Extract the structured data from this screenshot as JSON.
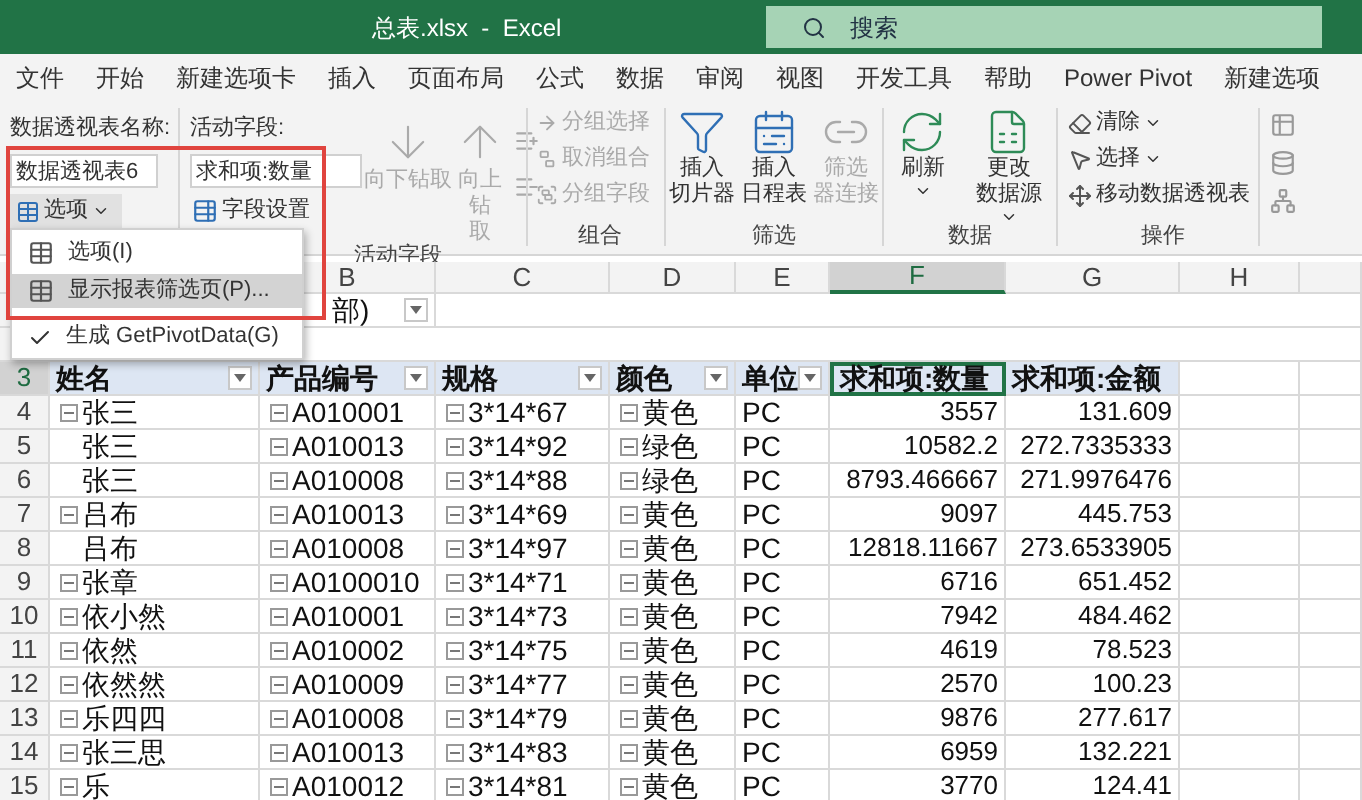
{
  "window": {
    "title": "总表.xlsx  -  Excel",
    "search": {
      "placeholder": "搜索"
    }
  },
  "tabs": [
    "文件",
    "开始",
    "新建选项卡",
    "插入",
    "页面布局",
    "公式",
    "数据",
    "审阅",
    "视图",
    "开发工具",
    "帮助",
    "Power Pivot",
    "新建选项"
  ],
  "ribbon": {
    "pivot": {
      "label": "数据透视表名称:",
      "value": "数据透视表6",
      "button": "选项"
    },
    "active_field": {
      "label": "活动字段:",
      "value": "求和项:数量",
      "button": "字段设置",
      "drill_down": {
        "label_lines": [
          "向下钻取"
        ],
        "disabled": true
      },
      "drill_up": {
        "label_lines": [
          "向上钻",
          "取"
        ],
        "disabled": true
      },
      "group_label": "活动字段"
    },
    "group": {
      "items": [
        {
          "label": "分组选择",
          "disabled": true
        },
        {
          "label": "取消组合",
          "disabled": true
        },
        {
          "label": "分组字段",
          "disabled": true
        }
      ],
      "group_label": "组合"
    },
    "filter": {
      "items": [
        {
          "kind": "slicer",
          "label_lines": [
            "插入",
            "切片器"
          ],
          "disabled": false
        },
        {
          "kind": "timeline",
          "label_lines": [
            "插入",
            "日程表"
          ],
          "disabled": false
        },
        {
          "kind": "connections",
          "label_lines": [
            "筛选",
            "器连接"
          ],
          "disabled": true
        }
      ],
      "group_label": "筛选"
    },
    "data": {
      "items": [
        {
          "kind": "refresh",
          "label_lines": [
            "刷新"
          ]
        },
        {
          "kind": "source",
          "label_lines": [
            "更改",
            "数据源"
          ]
        }
      ],
      "group_label": "数据"
    },
    "actions": {
      "items": [
        {
          "kind": "clear",
          "label": "清除",
          "dropdown": true
        },
        {
          "kind": "select",
          "label": "选择",
          "dropdown": true
        },
        {
          "kind": "move",
          "label": "移动数据透视表",
          "dropdown": false
        }
      ],
      "group_label": "操作"
    }
  },
  "menu": {
    "items": [
      {
        "kind": "icon",
        "label": "选项(I)",
        "selected": false,
        "checked": false
      },
      {
        "kind": "icon",
        "label": "显示报表筛选页(P)...",
        "selected": true,
        "checked": false
      },
      {
        "kind": "check",
        "label": "生成 GetPivotData(G)",
        "selected": false,
        "checked": true
      }
    ]
  },
  "sheet": {
    "column_headers": [
      {
        "label": "B",
        "selected": false
      },
      {
        "label": "C",
        "selected": false
      },
      {
        "label": "D",
        "selected": false
      },
      {
        "label": "E",
        "selected": false
      },
      {
        "label": "F",
        "selected": true
      },
      {
        "label": "G",
        "selected": false
      },
      {
        "label": "H",
        "selected": false
      }
    ],
    "filter_cell": {
      "value": "部)"
    },
    "header_row": {
      "row_number": "3",
      "selected": true,
      "cells": [
        {
          "label": "姓名",
          "filter": true,
          "selected": false
        },
        {
          "label": "产品编号",
          "filter": true,
          "selected": false
        },
        {
          "label": "规格",
          "filter": true,
          "selected": false
        },
        {
          "label": "颜色",
          "filter": true,
          "selected": false
        },
        {
          "label": "单位",
          "filter": true,
          "selected": false
        },
        {
          "label": "求和项:数量",
          "filter": false,
          "selected": true
        },
        {
          "label": "求和项:金额",
          "filter": false,
          "selected": false
        }
      ]
    },
    "rows": [
      {
        "row_number": "4",
        "name": "张三",
        "name_toggle": true,
        "code": "A010001",
        "spec": "3*14*67",
        "color_text": "黄色",
        "unit": "PC",
        "qty": "3557",
        "amount": "131.609"
      },
      {
        "row_number": "5",
        "name": "张三",
        "name_toggle": false,
        "code": "A010013",
        "spec": "3*14*92",
        "color_text": "绿色",
        "unit": "PC",
        "qty": "10582.2",
        "amount": "272.7335333"
      },
      {
        "row_number": "6",
        "name": "张三",
        "name_toggle": false,
        "code": "A010008",
        "spec": "3*14*88",
        "color_text": "绿色",
        "unit": "PC",
        "qty": "8793.466667",
        "amount": "271.9976476"
      },
      {
        "row_number": "7",
        "name": "吕布",
        "name_toggle": true,
        "code": "A010013",
        "spec": "3*14*69",
        "color_text": "黄色",
        "unit": "PC",
        "qty": "9097",
        "amount": "445.753"
      },
      {
        "row_number": "8",
        "name": "吕布",
        "name_toggle": false,
        "code": "A010008",
        "spec": "3*14*97",
        "color_text": "黄色",
        "unit": "PC",
        "qty": "12818.11667",
        "amount": "273.6533905"
      },
      {
        "row_number": "9",
        "name": "张章",
        "name_toggle": true,
        "code": "A0100010",
        "spec": "3*14*71",
        "color_text": "黄色",
        "unit": "PC",
        "qty": "6716",
        "amount": "651.452"
      },
      {
        "row_number": "10",
        "name": "依小然",
        "name_toggle": true,
        "code": "A010001",
        "spec": "3*14*73",
        "color_text": "黄色",
        "unit": "PC",
        "qty": "7942",
        "amount": "484.462"
      },
      {
        "row_number": "11",
        "name": "依然",
        "name_toggle": true,
        "code": "A010002",
        "spec": "3*14*75",
        "color_text": "黄色",
        "unit": "PC",
        "qty": "4619",
        "amount": "78.523"
      },
      {
        "row_number": "12",
        "name": "依然然",
        "name_toggle": true,
        "code": "A010009",
        "spec": "3*14*77",
        "color_text": "黄色",
        "unit": "PC",
        "qty": "2570",
        "amount": "100.23"
      },
      {
        "row_number": "13",
        "name": "乐四四",
        "name_toggle": true,
        "code": "A010008",
        "spec": "3*14*79",
        "color_text": "黄色",
        "unit": "PC",
        "qty": "9876",
        "amount": "277.617"
      },
      {
        "row_number": "14",
        "name": "张三思",
        "name_toggle": true,
        "code": "A010013",
        "spec": "3*14*83",
        "color_text": "黄色",
        "unit": "PC",
        "qty": "6959",
        "amount": "132.221"
      },
      {
        "row_number": "15",
        "name": "乐",
        "name_toggle": true,
        "code": "A010012",
        "spec": "3*14*81",
        "color_text": "黄色",
        "unit": "PC",
        "qty": "3770",
        "amount": "124.41"
      }
    ]
  }
}
